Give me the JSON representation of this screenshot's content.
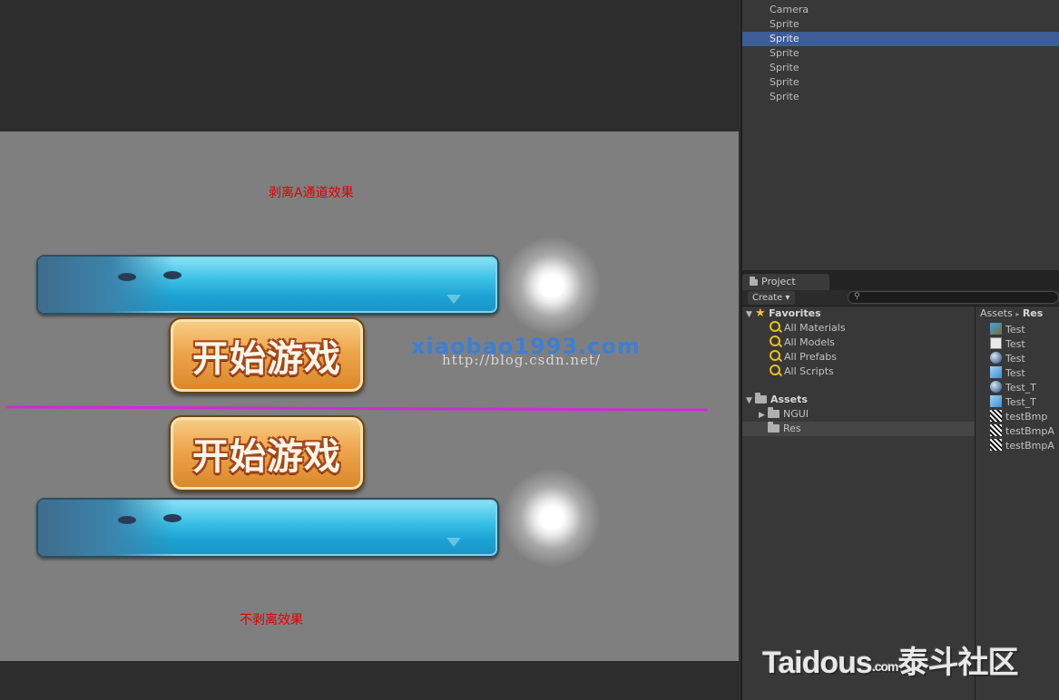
{
  "game_view": {
    "label_top": "剥离A通道效果",
    "label_bottom": "不剥离效果",
    "button_text": "开始游戏",
    "watermark_text": "xiaobao1993.com",
    "watermark_url": "http://blog.csdn.net/",
    "divider_color": "#d02ad8"
  },
  "hierarchy": {
    "items": [
      {
        "label": "Camera",
        "selected": false
      },
      {
        "label": "Sprite",
        "selected": false
      },
      {
        "label": "Sprite",
        "selected": true
      },
      {
        "label": "Sprite",
        "selected": false
      },
      {
        "label": "Sprite",
        "selected": false
      },
      {
        "label": "Sprite",
        "selected": false
      },
      {
        "label": "Sprite",
        "selected": false
      }
    ],
    "selected_color": "#3d5d97"
  },
  "project": {
    "tab_label": "Project",
    "create_label": "Create ▾",
    "favorites": {
      "title": "Favorites",
      "items": [
        "All Materials",
        "All Models",
        "All Prefabs",
        "All Scripts"
      ]
    },
    "assets": {
      "title": "Assets",
      "folders": [
        "NGUI",
        "Res"
      ],
      "selected_folder": "Res"
    },
    "breadcrumb": {
      "root": "Assets",
      "sep": "▸",
      "current": "Res"
    },
    "files": [
      {
        "name": "Test",
        "icon": "prefab-icon"
      },
      {
        "name": "Test",
        "icon": "script-icon"
      },
      {
        "name": "Test",
        "icon": "material-icon"
      },
      {
        "name": "Test",
        "icon": "cube-icon"
      },
      {
        "name": "Test_T",
        "icon": "material-icon"
      },
      {
        "name": "Test_T",
        "icon": "cube-icon"
      },
      {
        "name": "testBmp",
        "icon": "texture-icon"
      },
      {
        "name": "testBmpA",
        "icon": "texture-icon"
      },
      {
        "name": "testBmpA",
        "icon": "texture-icon"
      }
    ]
  },
  "site_watermark": {
    "brand": "Taidous",
    "suffix": ".com",
    "cn": "泰斗社区"
  }
}
